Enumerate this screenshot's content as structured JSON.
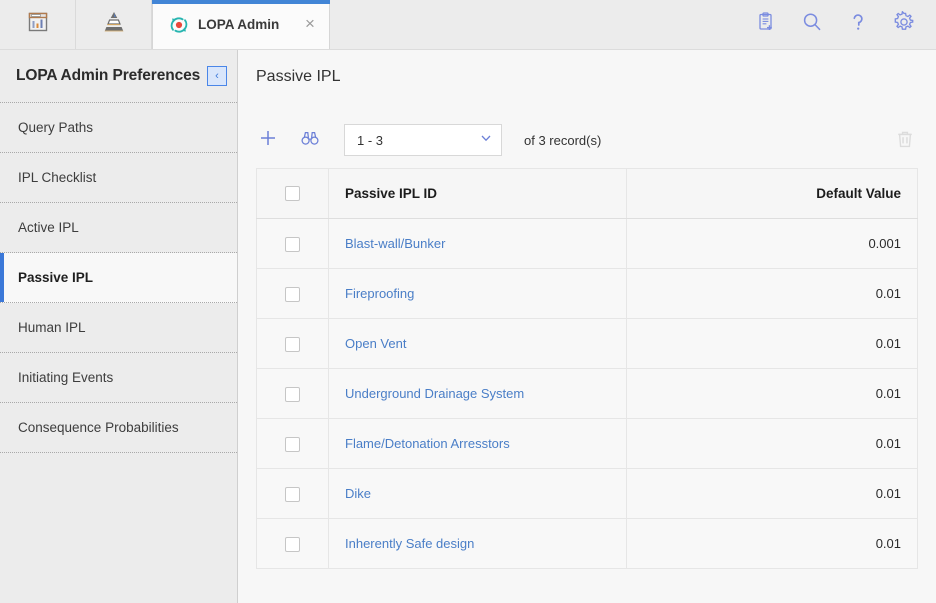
{
  "topbar": {
    "left_icons": [
      {
        "name": "dashboard-icon",
        "title": "Dashboard"
      },
      {
        "name": "hierarchy-pyramid-icon",
        "title": "Hierarchy"
      }
    ],
    "tab": {
      "label": "LOPA Admin",
      "icon": "lopa-refresh-icon",
      "close_glyph": "×"
    },
    "actions": [
      {
        "name": "clipboard-add-icon",
        "title": "New Task"
      },
      {
        "name": "search-icon",
        "title": "Search"
      },
      {
        "name": "help-icon",
        "title": "Help"
      },
      {
        "name": "gear-icon",
        "title": "Settings"
      }
    ],
    "accent_color": "#4285d6",
    "action_color": "#7b8ce0"
  },
  "sidebar": {
    "title": "LOPA Admin Preferences",
    "collapse_glyph": "‹",
    "active_index": 3,
    "items": [
      {
        "label": "Query Paths"
      },
      {
        "label": "IPL Checklist"
      },
      {
        "label": "Active IPL"
      },
      {
        "label": "Passive IPL"
      },
      {
        "label": "Human IPL"
      },
      {
        "label": "Initiating Events"
      },
      {
        "label": "Consequence Probabilities"
      }
    ]
  },
  "main": {
    "page_title": "Passive IPL",
    "toolbar": {
      "add_icon": "plus-icon",
      "find_icon": "binoculars-icon",
      "page_range": "1 - 3",
      "record_count_text": "of  3  record(s)",
      "delete_icon": "trash-icon"
    },
    "table": {
      "columns": [
        {
          "key": "select",
          "label": ""
        },
        {
          "key": "id",
          "label": "Passive IPL ID"
        },
        {
          "key": "value",
          "label": "Default Value"
        }
      ],
      "rows": [
        {
          "id": "Blast-wall/Bunker",
          "value": "0.001"
        },
        {
          "id": "Fireproofing",
          "value": "0.01"
        },
        {
          "id": "Open Vent",
          "value": "0.01"
        },
        {
          "id": "Underground Drainage System",
          "value": "0.01"
        },
        {
          "id": "Flame/Detonation Arresstors",
          "value": "0.01"
        },
        {
          "id": "Dike",
          "value": "0.01"
        },
        {
          "id": "Inherently Safe design",
          "value": "0.01"
        }
      ]
    }
  }
}
